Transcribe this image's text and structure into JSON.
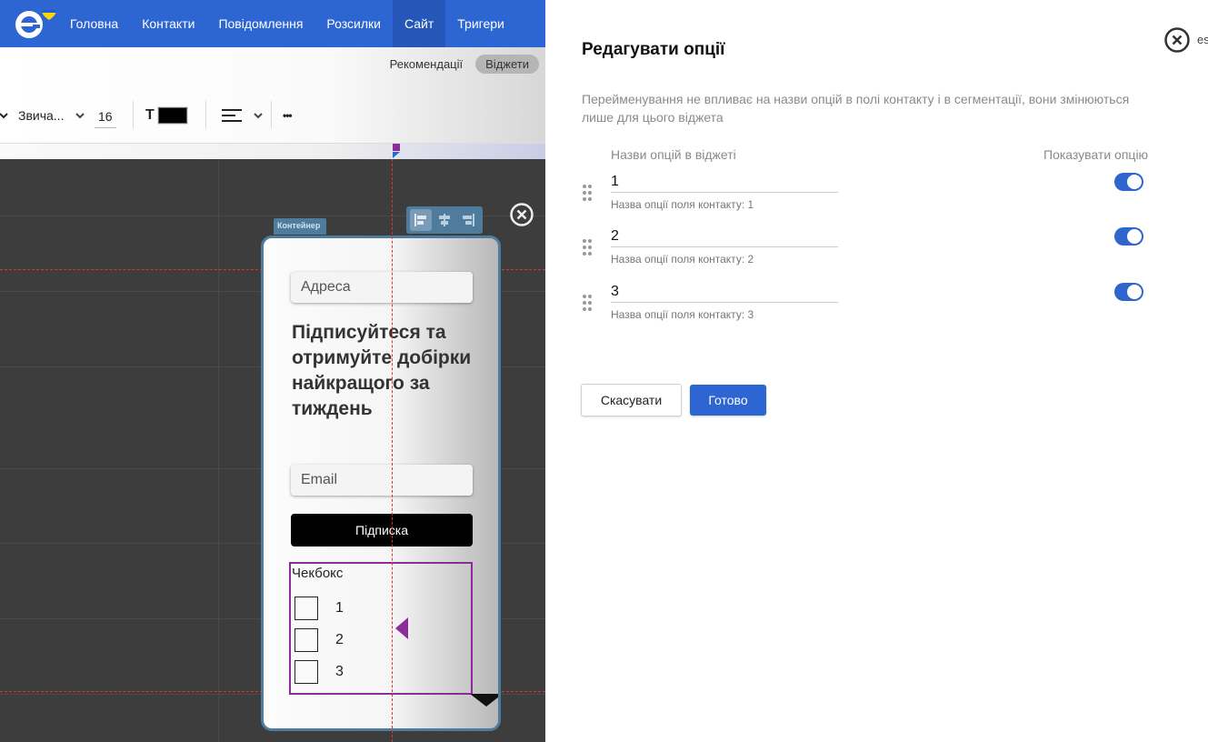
{
  "nav": {
    "items": [
      "Головна",
      "Контакти",
      "Повідомлення",
      "Розсилки",
      "Сайт",
      "Тригери"
    ],
    "active_index": 4
  },
  "subtabs": {
    "recommendations": "Рекомендації",
    "widgets": "Віджети"
  },
  "toolbar": {
    "font_style": "Звича...",
    "font_size": "16",
    "text_color_label": "T",
    "text_color": "#000000",
    "more_label": "•••"
  },
  "canvas": {
    "container_label": "Контейнер",
    "widget": {
      "address_placeholder": "Адреса",
      "heading": "Підписуйтеся та отримуйте добірки найкращого за тиждень",
      "email_placeholder": "Email",
      "subscribe_button": "Підписка",
      "checkbox_title": "Чекбокс",
      "checkbox_options": [
        "1",
        "2",
        "3"
      ]
    }
  },
  "panel": {
    "title": "Редагувати опції",
    "esc_label": "esc",
    "description": "Перейменування не впливає на назви опцій в полі контакту і в сегментації, вони змінюються лише для цього віджета",
    "col_names": "Назви опцій в віджеті",
    "col_show": "Показувати опцію",
    "options": [
      {
        "value": "1",
        "hint": "Назва опції поля контакту: 1",
        "shown": true
      },
      {
        "value": "2",
        "hint": "Назва опції поля контакту: 2",
        "shown": true
      },
      {
        "value": "3",
        "hint": "Назва опції поля контакту: 3",
        "shown": true
      }
    ],
    "cancel_label": "Скасувати",
    "done_label": "Готово"
  },
  "colors": {
    "brand_blue": "#2d66d2",
    "toggle_on": "#2e66cc",
    "selection_purple": "#8b2c9a",
    "container_blue": "#4f7c9c"
  }
}
